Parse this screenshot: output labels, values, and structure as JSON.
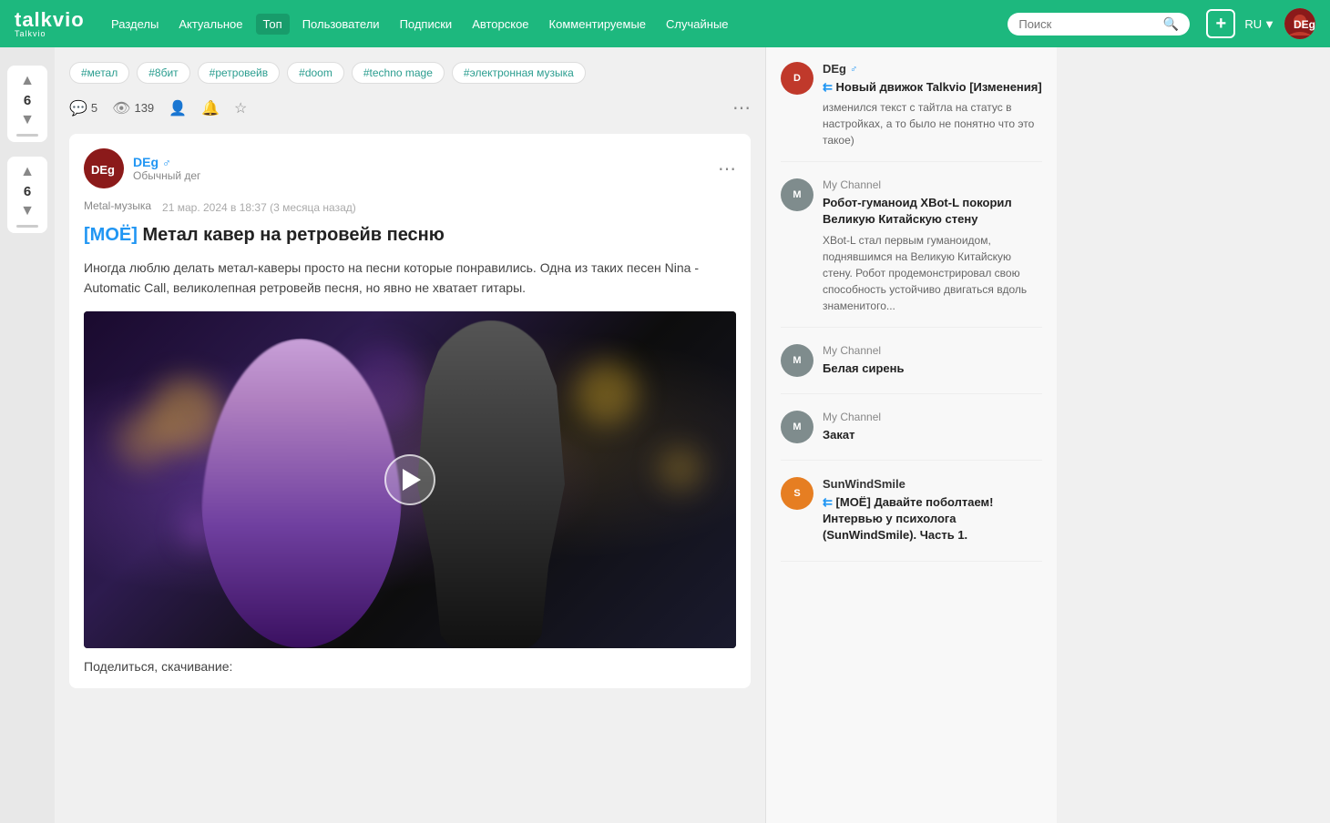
{
  "header": {
    "logo": "talkvio",
    "logo_sub": "Talkvio",
    "nav": [
      {
        "label": "Разделы",
        "active": false
      },
      {
        "label": "Актуальное",
        "active": false
      },
      {
        "label": "Топ",
        "active": true
      },
      {
        "label": "Пользователи",
        "active": false
      },
      {
        "label": "Подписки",
        "active": false
      },
      {
        "label": "Авторское",
        "active": false
      },
      {
        "label": "Комментируемые",
        "active": false
      },
      {
        "label": "Случайные",
        "active": false
      }
    ],
    "search_placeholder": "Поиск",
    "add_button": "+",
    "language": "RU"
  },
  "left_votes": [
    {
      "count": "6"
    },
    {
      "count": "6"
    }
  ],
  "tags": [
    "#метал",
    "#8бит",
    "#ретровейв",
    "#doom",
    "#techno mage",
    "#электронная музыка"
  ],
  "post_meta": {
    "comments": "5",
    "views": "139"
  },
  "post": {
    "author": "DEg",
    "author_gender": "♂",
    "author_status": "Обычный дег",
    "category": "Metal-музыка",
    "date": "21 мар. 2024 в 18:37 (3 месяца назад)",
    "title": "[МОЁ] Метал кавер на ретровейв песню",
    "body": "Иногда люблю делать метал-каверы просто на песни которые понравились. Одна из таких песен Nina - Automatic Call, великолепная ретровейв песня, но явно не хватает гитары.",
    "footer_text": "Поделиться, скачивание:"
  },
  "right_sidebar": {
    "posts": [
      {
        "author": "DEg",
        "author_gender": "♂",
        "avatar_class": "av-red",
        "avatar_letter": "D",
        "is_channel": false,
        "title": "Новый движок Talkvio [Изменения]",
        "double_arrow": true,
        "excerpt": "изменился текст с тайтла на статус в настройках, а то было не понятно что это такое)"
      },
      {
        "author": "My Channel",
        "avatar_class": "av-gray",
        "avatar_letter": "M",
        "is_channel": true,
        "title": "Робот-гуманоид XBot-L покорил Великую Китайскую стену",
        "double_arrow": false,
        "excerpt": "XBot-L стал первым гуманоидом, поднявшимся на Великую Китайскую стену. Робот продемонстрировал свою способность устойчиво двигаться вдоль знаменитого..."
      },
      {
        "author": "My Channel",
        "avatar_class": "av-gray",
        "avatar_letter": "M",
        "is_channel": true,
        "title": "Белая сирень",
        "double_arrow": false,
        "excerpt": ""
      },
      {
        "author": "My Channel",
        "avatar_class": "av-gray",
        "avatar_letter": "M",
        "is_channel": true,
        "title": "Закат",
        "double_arrow": false,
        "excerpt": ""
      },
      {
        "author": "SunWindSmile",
        "avatar_class": "av-orange",
        "avatar_letter": "S",
        "is_channel": false,
        "title": "[МОЁ] Давайте поболтаем! Интервью у психолога (SunWindSmile). Часть 1.",
        "double_arrow": true,
        "excerpt": ""
      }
    ]
  }
}
